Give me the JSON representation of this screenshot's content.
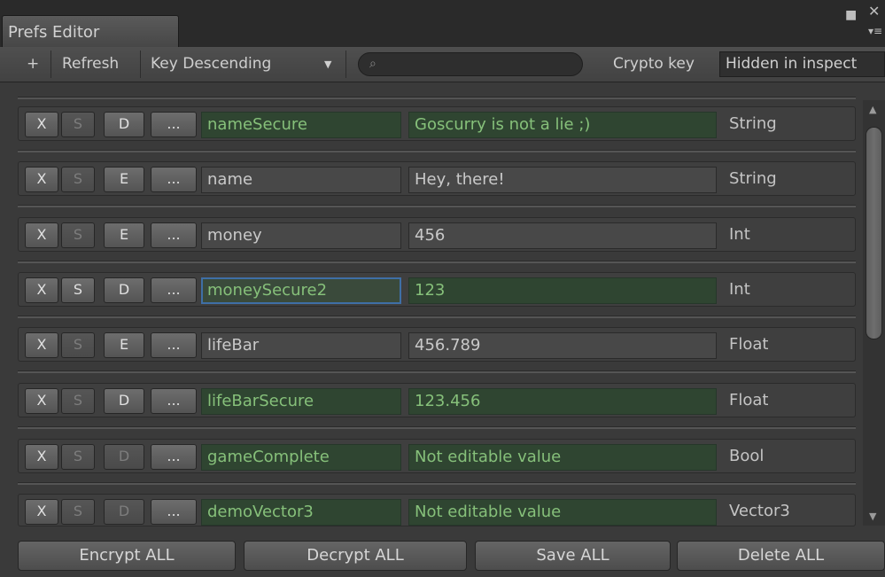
{
  "window": {
    "tab_title": "Prefs Editor"
  },
  "toolbar": {
    "add_label": "+",
    "refresh_label": "Refresh",
    "sort_label": "Key Descending",
    "search_placeholder": "",
    "crypto_label": "Crypto key",
    "crypto_value": "Hidden in inspect"
  },
  "rows": [
    {
      "x": "X",
      "s": "S",
      "de": "D",
      "more": "...",
      "key": "nameSecure",
      "value": "Goscurry is not a lie ;)",
      "type": "String"
    },
    {
      "x": "X",
      "s": "S",
      "de": "E",
      "more": "...",
      "key": "name",
      "value": "Hey, there!",
      "type": "String"
    },
    {
      "x": "X",
      "s": "S",
      "de": "E",
      "more": "...",
      "key": "money",
      "value": "456",
      "type": "Int"
    },
    {
      "x": "X",
      "s": "S",
      "de": "D",
      "more": "...",
      "key": "moneySecure2",
      "value": "123",
      "type": "Int"
    },
    {
      "x": "X",
      "s": "S",
      "de": "E",
      "more": "...",
      "key": "lifeBar",
      "value": "456.789",
      "type": "Float"
    },
    {
      "x": "X",
      "s": "S",
      "de": "D",
      "more": "...",
      "key": "lifeBarSecure",
      "value": "123.456",
      "type": "Float"
    },
    {
      "x": "X",
      "s": "S",
      "de": "D",
      "more": "...",
      "key": "gameComplete",
      "value": "Not editable value",
      "type": "Bool"
    },
    {
      "x": "X",
      "s": "S",
      "de": "D",
      "more": "...",
      "key": "demoVector3",
      "value": "Not editable value",
      "type": "Vector3"
    }
  ],
  "bottom": {
    "encrypt_all": "Encrypt ALL",
    "decrypt_all": "Decrypt ALL",
    "save_all": "Save ALL",
    "delete_all": "Delete ALL"
  },
  "colors": {
    "secure_field_bg": "#2f4531",
    "secure_text": "#86c07a",
    "focus_border": "#3f6fa6"
  }
}
